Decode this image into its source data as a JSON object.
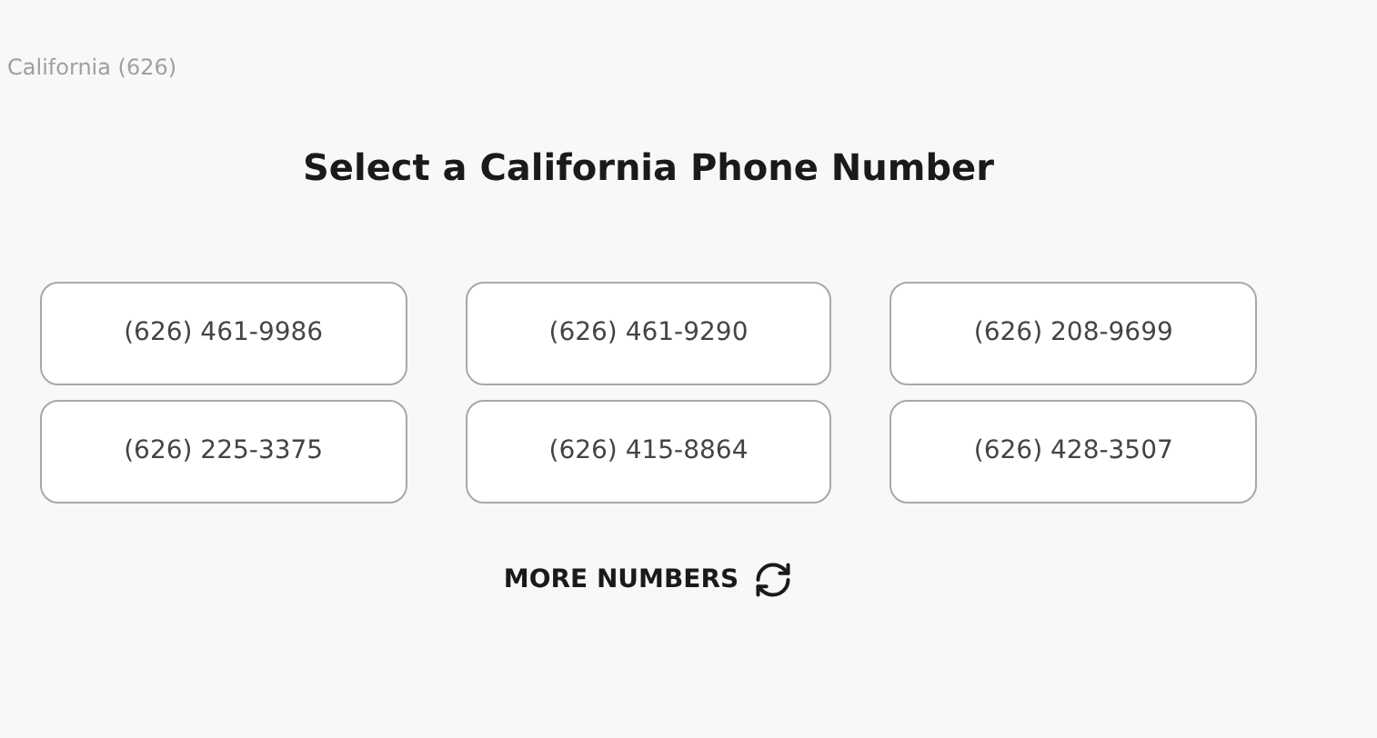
{
  "breadcrumb": "California (626)",
  "title": "Select a California Phone Number",
  "numbers": [
    "(626) 461-9986",
    "(626) 461-9290",
    "(626) 208-9699",
    "(626) 225-3375",
    "(626) 415-8864",
    "(626) 428-3507"
  ],
  "more_button": "MORE NUMBERS"
}
